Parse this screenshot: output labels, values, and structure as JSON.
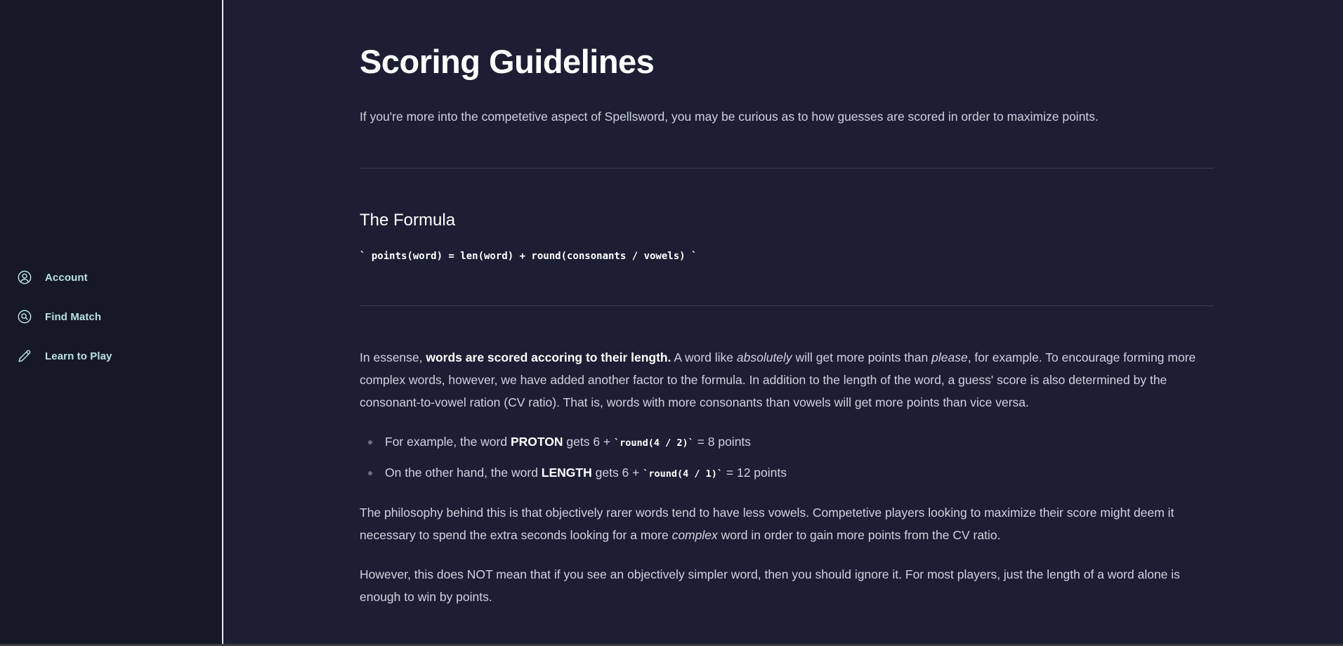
{
  "sidebar": {
    "items": [
      {
        "label": "Account",
        "icon": "user-circle-icon"
      },
      {
        "label": "Find Match",
        "icon": "search-circle-icon"
      },
      {
        "label": "Learn to Play",
        "icon": "pencil-icon"
      }
    ]
  },
  "main": {
    "title": "Scoring Guidelines",
    "intro": "If you're more into the competetive aspect of Spellsword, you may be curious as to how guesses are scored in order to maximize points.",
    "formula_section": {
      "title": "The Formula",
      "code": "` points(word) = len(word) + round(consonants / vowels) `"
    },
    "explanation": {
      "p1_part1": "In essense, ",
      "p1_strong": "words are scored accoring to their length.",
      "p1_part2": " A word like ",
      "p1_em1": "absolutely",
      "p1_part3": " will get more points than ",
      "p1_em2": "please",
      "p1_part4": ", for example. To encourage forming more complex words, however, we have added another factor to the formula. In addition to the length of the word, a guess' score is also determined by the consonant-to-vowel ration (CV ratio). That is, words with more consonants than vowels will get more points than vice versa.",
      "examples": [
        {
          "pre": "For example, the word ",
          "word": "PROTON",
          "mid": " gets 6 + ",
          "code": "`round(4 / 2)`",
          "post": " = 8 points"
        },
        {
          "pre": "On the other hand, the word ",
          "word": "LENGTH",
          "mid": " gets 6 + ",
          "code": "`round(4 / 1)`",
          "post": " = 12 points"
        }
      ],
      "p2_part1": "The philosophy behind this is that objectively rarer words tend to have less vowels. Competetive players looking to maximize their score might deem it necessary to spend the extra seconds looking for a more ",
      "p2_em": "complex",
      "p2_part2": " word in order to gain more points from the CV ratio.",
      "p3": "However, this does NOT mean that if you see an objectively simpler word, then you should ignore it. For most players, just the length of a word alone is enough to win by points."
    }
  },
  "colors": {
    "background": "#1c1f33",
    "sidebar": "#161827",
    "accent": "#b9e2e0"
  }
}
